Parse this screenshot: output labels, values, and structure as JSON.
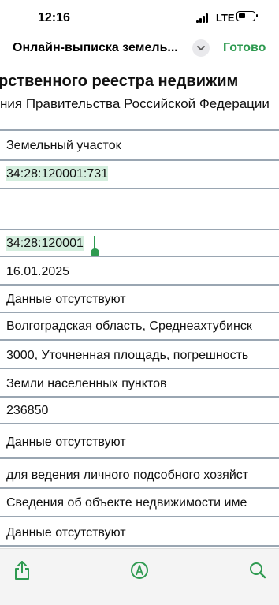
{
  "status_bar": {
    "time": "12:16",
    "network": "LTE"
  },
  "nav": {
    "title": "Онлайн-выписка земель...",
    "done_label": "Готово"
  },
  "document": {
    "heading": "рственного реестра недвижим",
    "subheading": "ния Правительства Российской Федерации",
    "rows": [
      "Земельный участок",
      "34:28:120001:731",
      "",
      "34:28:120001",
      "16.01.2025",
      "Данные отсутствуют",
      "Волгоградская область, Среднеахтубинск",
      "3000, Уточненная площадь, погрешность",
      "Земли населенных пунктов",
      "236850",
      "Данные отсутствуют",
      "для ведения личного подсобного хозяйст",
      "Сведения об объекте недвижимости име",
      "Данные отсутствуют"
    ]
  },
  "toolbar": {
    "icons": [
      "share-icon",
      "markup-icon",
      "search-icon"
    ]
  },
  "colors": {
    "accent": "#2e9a50",
    "highlight": "#d4eede",
    "divider": "#9aa6b2"
  }
}
